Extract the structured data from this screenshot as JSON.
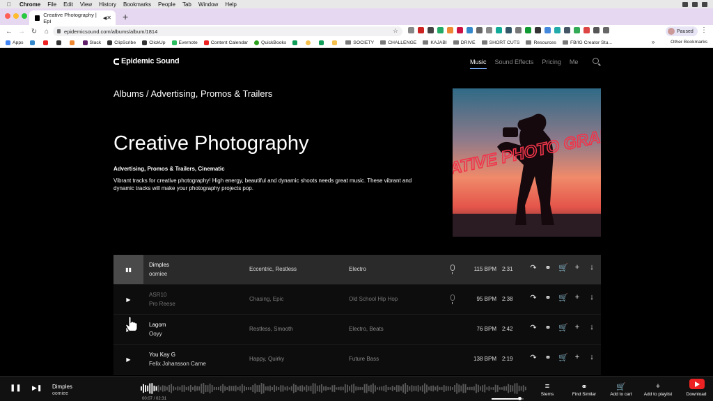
{
  "macos": {
    "app": "Chrome",
    "menus": [
      "File",
      "Edit",
      "View",
      "History",
      "Bookmarks",
      "People",
      "Tab",
      "Window",
      "Help"
    ]
  },
  "browser": {
    "tab_title": "Creative Photography | Epi",
    "url": "epidemicsound.com/albums/album/1814",
    "profile_label": "Paused"
  },
  "bookmarks": [
    "Apps",
    "Slack",
    "ClipScribe",
    "ClickUp",
    "Evernote",
    "Content Calendar",
    "QuickBooks",
    "SOCIETY",
    "CHALLENGE",
    "KAJABI",
    "DRIVE",
    "SHORT CUTS",
    "Resources",
    "FB/IG Creator Stu..."
  ],
  "bookmarks_other": "Other Bookmarks",
  "site": {
    "logo": "Epidemic Sound",
    "nav": [
      "Music",
      "Sound Effects",
      "Pricing",
      "Me"
    ],
    "breadcrumb": "Albums / Advertising, Promos & Trailers",
    "album": {
      "title": "Creative Photography",
      "tags": "Advertising, Promos & Trailers, Cinematic",
      "description": "Vibrant tracks for creative photography! High energy, beautiful and dynamic shoots needs great music. These vibrant and dynamic tracks will make your photography projects pop.",
      "cover_text": "CREATIVE PHOTO GRAPHY"
    }
  },
  "tracks": [
    {
      "name": "Dimples",
      "artist": "oomiee",
      "moods": "Eccentric, Restless",
      "genres": "Electro",
      "bpm": "115 BPM",
      "duration": "2:31"
    },
    {
      "name": "ASR10",
      "artist": "Pro Reese",
      "moods": "Chasing, Epic",
      "genres": "Old School Hip Hop",
      "bpm": "95 BPM",
      "duration": "2:38"
    },
    {
      "name": "Lagom",
      "artist": "Ooyy",
      "moods": "Restless, Smooth",
      "genres": "Electro, Beats",
      "bpm": "76 BPM",
      "duration": "2:42"
    },
    {
      "name": "You Kay G",
      "artist": "Felix Johansson Carne",
      "moods": "Happy, Quirky",
      "genres": "Future Bass",
      "bpm": "138 BPM",
      "duration": "2:19"
    }
  ],
  "player": {
    "track_name": "Dimples",
    "artist": "oomiee",
    "time": "00:07 / 02:31",
    "progress": 0.046,
    "actions": [
      "Stems",
      "Find Similar",
      "Add to cart",
      "Add to playlist",
      "Download"
    ]
  },
  "colors": {
    "tab_strip": "#e6d8f0",
    "background": "#000000",
    "active_row": "#2a2a2a",
    "nav_underline": "#7fb3ff"
  }
}
